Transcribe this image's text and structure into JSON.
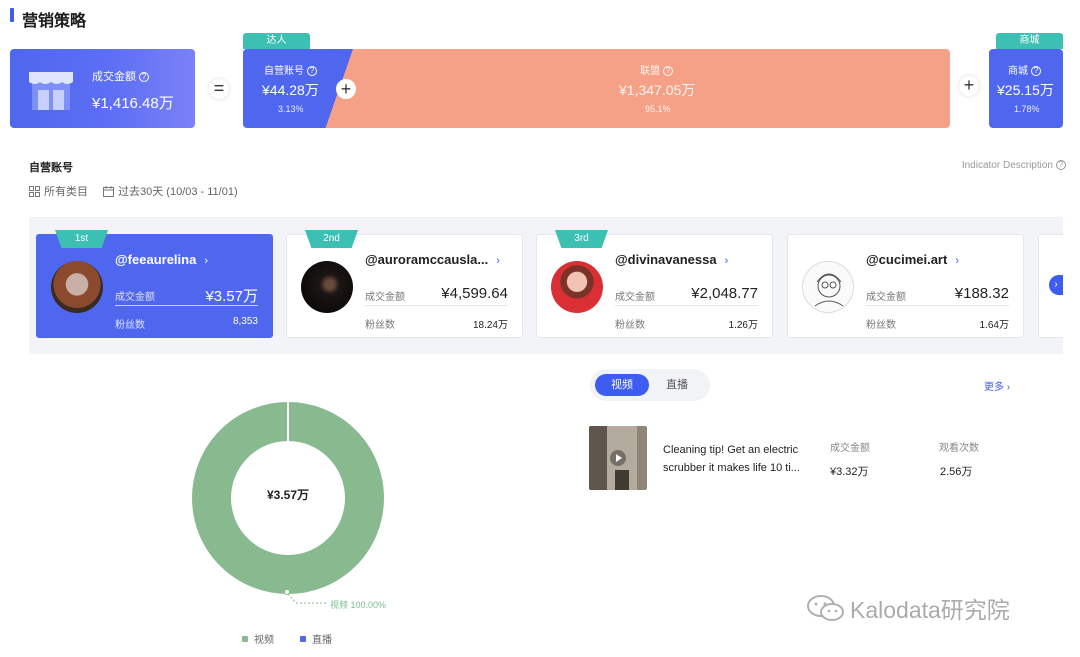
{
  "page": {
    "title": "营销策略"
  },
  "equation": {
    "total": {
      "label": "成交金额",
      "value": "¥1,416.48万"
    },
    "equals": "=",
    "plus": "+",
    "self": {
      "tag": "达人",
      "label": "自营账号",
      "value": "¥44.28万",
      "pct": "3.13%"
    },
    "union": {
      "label": "联盟",
      "value": "¥1,347.05万",
      "pct": "95.1%"
    },
    "mall": {
      "tag": "商城",
      "label": "商城",
      "value": "¥25.15万",
      "pct": "1.78%"
    },
    "colors": {
      "blue": "#4f67ee",
      "salmon": "#f4a187",
      "teal": "#3cc0b4"
    }
  },
  "section": {
    "title": "自营账号",
    "indicator": "Indicator Description",
    "category_filter": "所有类目",
    "date_filter": "过去30天 (10/03 - 11/01)"
  },
  "creators": [
    {
      "rank": "1st",
      "handle": "@feeaurelina",
      "gmv_label": "成交金额",
      "gmv": "¥3.57万",
      "fans_label": "粉丝数",
      "fans": "8,353"
    },
    {
      "rank": "2nd",
      "handle": "@auroramccausla...",
      "gmv_label": "成交金额",
      "gmv": "¥4,599.64",
      "fans_label": "粉丝数",
      "fans": "18.24万"
    },
    {
      "rank": "3rd",
      "handle": "@divinavanessa",
      "gmv_label": "成交金额",
      "gmv": "¥2,048.77",
      "fans_label": "粉丝数",
      "fans": "1.26万"
    },
    {
      "rank": "",
      "handle": "@cucimei.art",
      "gmv_label": "成交金额",
      "gmv": "¥188.32",
      "fans_label": "粉丝数",
      "fans": "1.64万"
    }
  ],
  "chart_data": {
    "type": "pie",
    "center_label": "¥3.57万",
    "series": [
      {
        "name": "视频",
        "value": 100.0,
        "label": "视频 100.00%",
        "color": "#88b98f"
      },
      {
        "name": "直播",
        "value": 0.0,
        "color": "#4f67ee"
      }
    ],
    "legend": [
      "视频",
      "直播"
    ],
    "legend_position": "bottom"
  },
  "content": {
    "tabs": [
      "视频",
      "直播"
    ],
    "active_tab": "视频",
    "more": "更多 ›",
    "video": {
      "title": "Cleaning tip! Get an electric scrubber it makes life 10 ti...",
      "gmv_label": "成交金额",
      "gmv": "¥3.32万",
      "views_label": "观看次数",
      "views": "2.56万"
    }
  },
  "watermark": "Kalodata研究院"
}
